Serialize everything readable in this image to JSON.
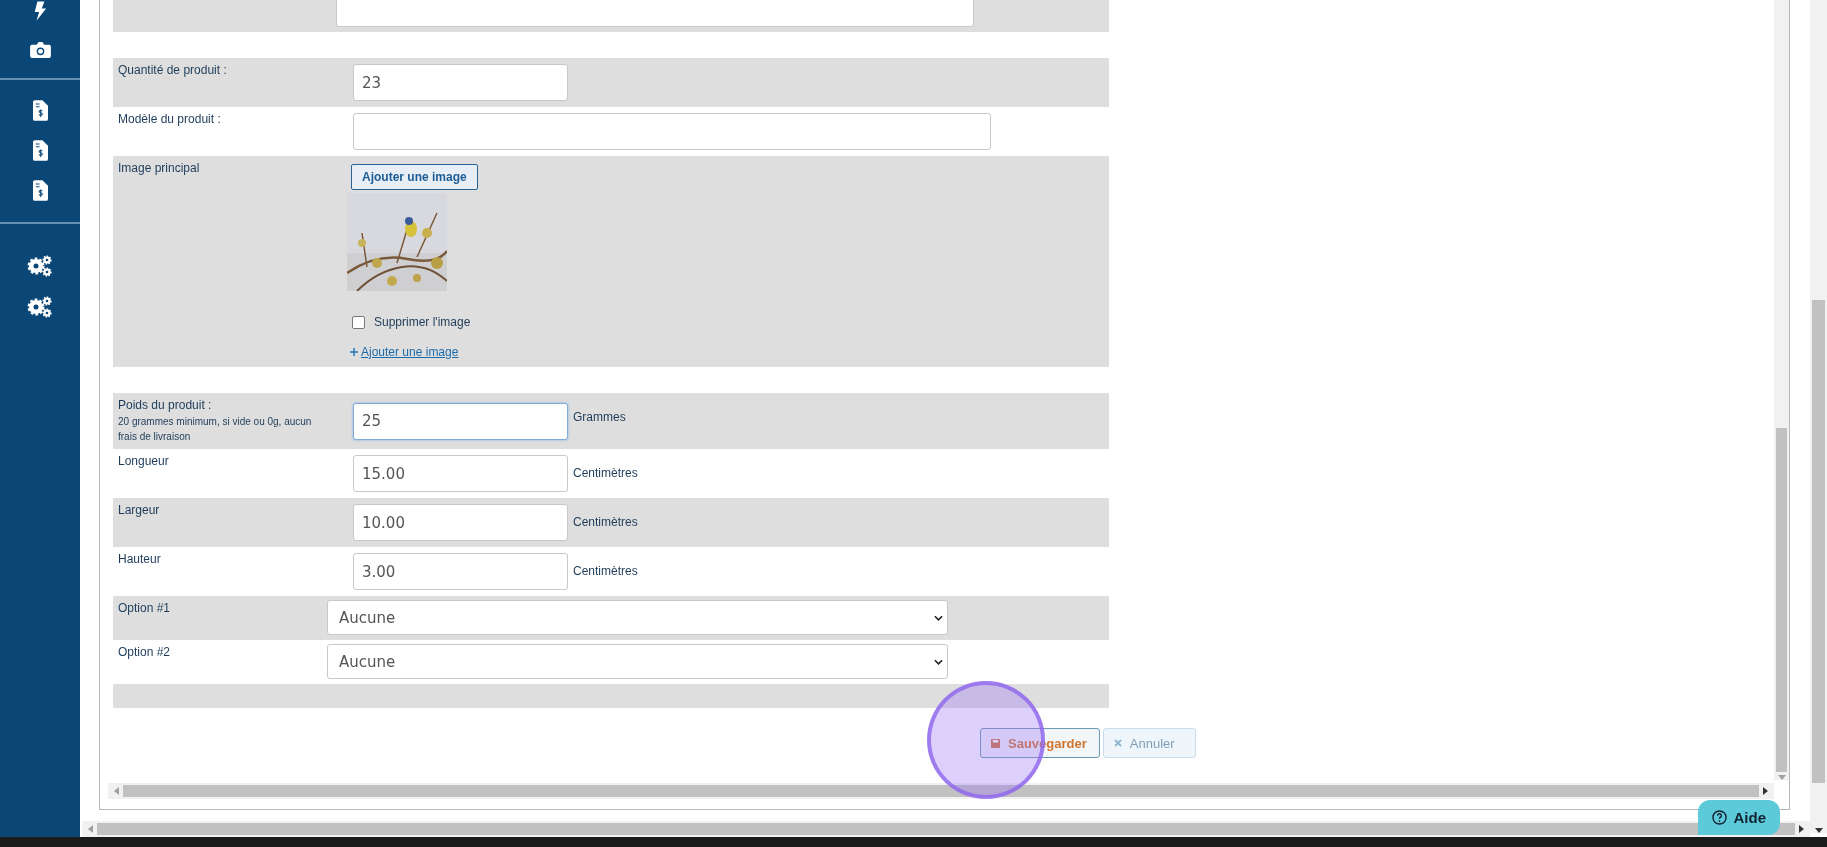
{
  "form": {
    "sections": [
      {
        "rows": [
          {
            "kind": "wide-text"
          }
        ]
      },
      {
        "rows": [
          {
            "kind": "text",
            "label": "Quantité de produit :",
            "value": "23"
          },
          {
            "kind": "wide-text",
            "label": "Modèle du produit :"
          },
          {
            "label": "Image principal",
            "button": "Ajouter une image",
            "checkbox": {
              "label": "Supprimer l'image",
              "checked": false
            },
            "link": "Ajouter une image"
          }
        ]
      },
      {
        "rows": [
          {
            "kind": "text",
            "label": "Poids du produit :",
            "note": "20 grammes minimum, si vide ou 0g, aucun frais de livraison",
            "value": "25",
            "unit": "Grammes",
            "focused": true
          },
          {
            "kind": "text",
            "label": "Longueur",
            "value": "15.00",
            "unit": "Centimètres"
          },
          {
            "kind": "text",
            "label": "Largeur",
            "value": "10.00",
            "unit": "Centimètres"
          },
          {
            "kind": "text",
            "label": "Hauteur",
            "value": "3.00",
            "unit": "Centimètres"
          },
          {
            "kind": "select",
            "label": "Option #1",
            "value": "Aucune"
          },
          {
            "kind": "select",
            "label": "Option #2",
            "value": "Aucune"
          }
        ]
      }
    ]
  },
  "actions": {
    "save": "Sauvegarder",
    "cancel": "Annuler"
  },
  "help_button": "Aide"
}
